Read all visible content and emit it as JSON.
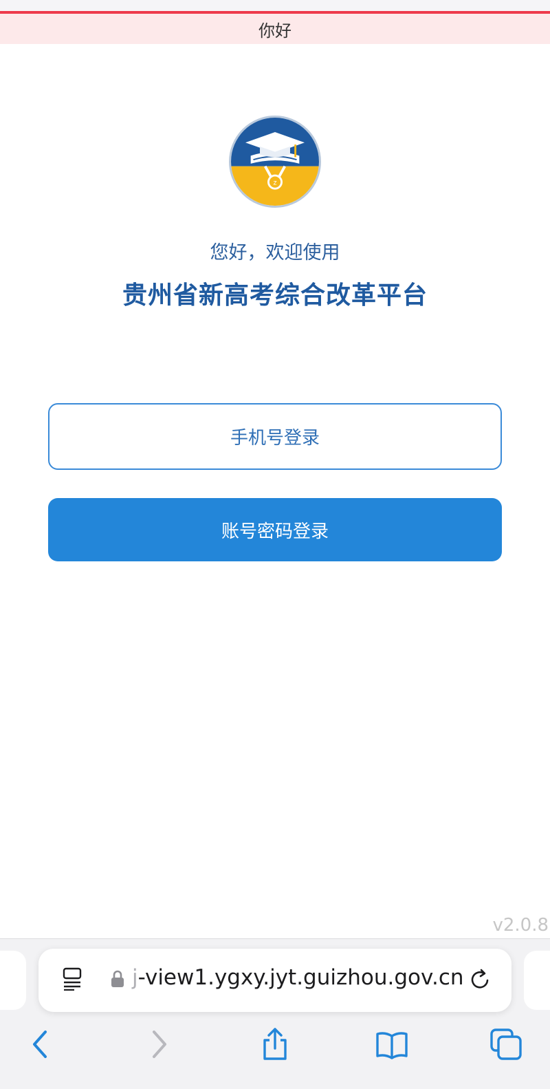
{
  "browser": {
    "page_title": "你好",
    "url_prefix": "j",
    "url_rest": "-view1.ygxy.jyt.guizhou.gov.cn"
  },
  "header": {
    "welcome_text": "您好，欢迎使用",
    "platform_name": "贵州省新高考综合改革平台"
  },
  "buttons": {
    "phone_login": "手机号登录",
    "account_login": "账号密码登录"
  },
  "footer": {
    "version": "v2.0.8"
  },
  "icons": {
    "logo": "graduation-cap-medal-logo",
    "reader": "reader-mode-icon",
    "lock": "lock-icon",
    "reload": "reload-icon",
    "back": "chevron-left-icon",
    "forward": "chevron-right-icon",
    "share": "share-icon",
    "bookmarks": "book-icon",
    "tabs": "tabs-icon"
  },
  "colors": {
    "accent": "#2386d9",
    "title": "#1f5aa0",
    "alert_line": "#ee3a4c",
    "logo_blue": "#1f5aa0",
    "logo_yellow": "#f5b71a"
  }
}
